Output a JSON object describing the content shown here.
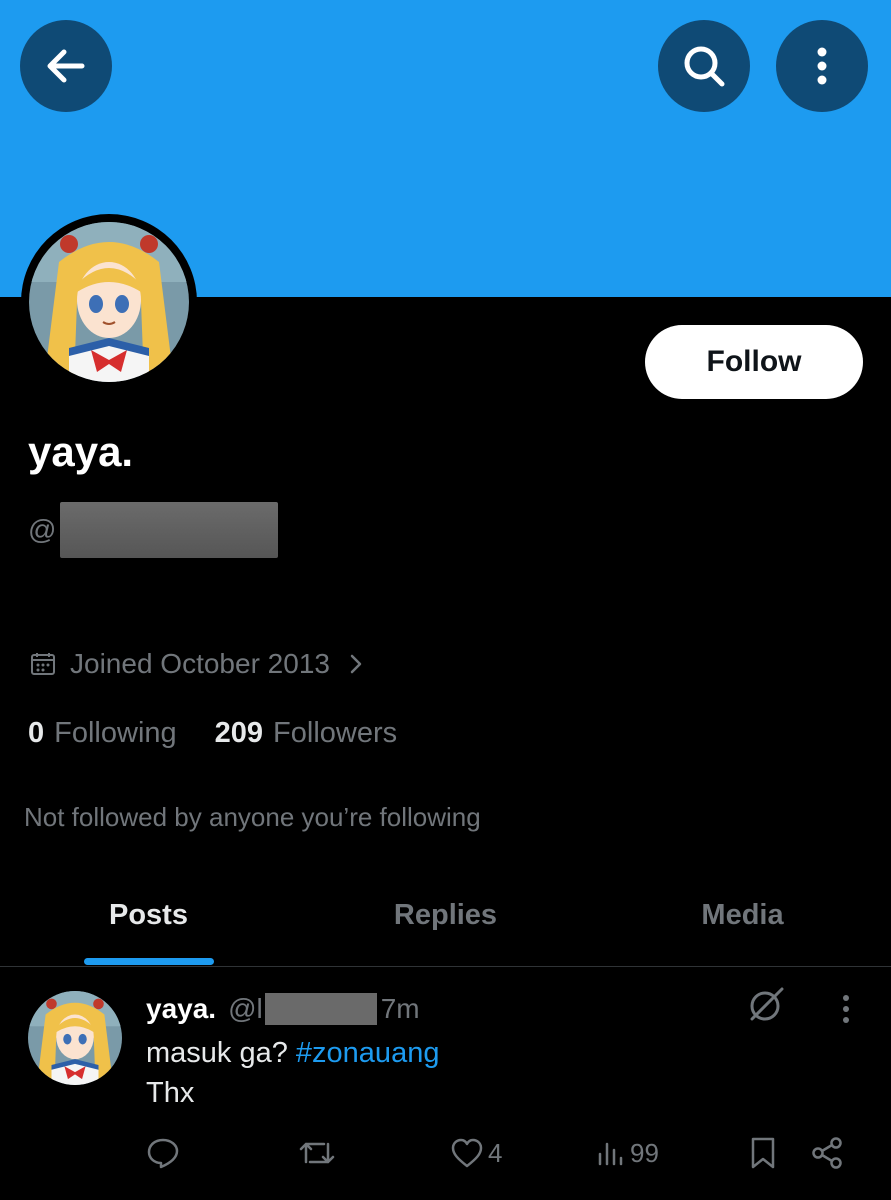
{
  "header": {
    "back_icon": "arrow-left-icon",
    "search_icon": "search-icon",
    "more_icon": "more-vertical-icon"
  },
  "profile": {
    "display_name": "yaya.",
    "handle_prefix": "@",
    "follow_label": "Follow",
    "joined": "Joined October 2013",
    "following_count": "0",
    "following_label": "Following",
    "followers_count": "209",
    "followers_label": "Followers",
    "not_followed_text": "Not followed by anyone you’re following"
  },
  "tabs": [
    {
      "label": "Posts"
    },
    {
      "label": "Replies"
    },
    {
      "label": "Media"
    }
  ],
  "post": {
    "name": "yaya.",
    "handle_prefix": "@l",
    "time": "7m",
    "text_line1": "masuk ga? ",
    "hashtag": "#zonauang",
    "text_line2": "Thx",
    "likes": "4",
    "views": "99"
  },
  "colors": {
    "banner": "#1d9bf0",
    "accent": "#1d9bf0",
    "muted": "#71767b",
    "button_dark": "#0f4a75"
  }
}
